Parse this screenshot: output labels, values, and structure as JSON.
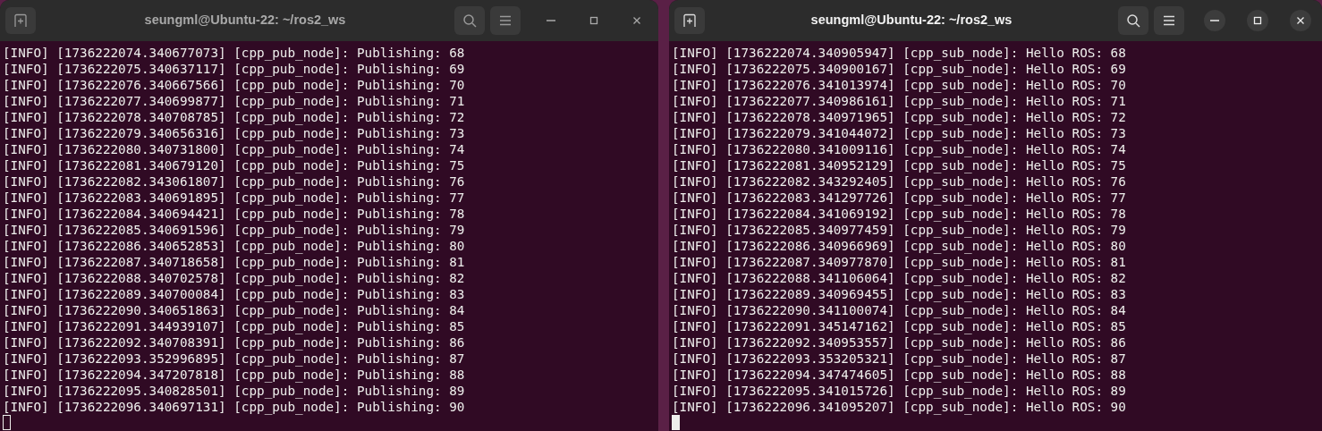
{
  "windows": [
    {
      "title": "seungml@Ubuntu-22: ~/ros2_ws",
      "active": false,
      "lines": [
        "[INFO] [1736222074.340677073] [cpp_pub_node]: Publishing: 68",
        "[INFO] [1736222075.340637117] [cpp_pub_node]: Publishing: 69",
        "[INFO] [1736222076.340667566] [cpp_pub_node]: Publishing: 70",
        "[INFO] [1736222077.340699877] [cpp_pub_node]: Publishing: 71",
        "[INFO] [1736222078.340708785] [cpp_pub_node]: Publishing: 72",
        "[INFO] [1736222079.340656316] [cpp_pub_node]: Publishing: 73",
        "[INFO] [1736222080.340731800] [cpp_pub_node]: Publishing: 74",
        "[INFO] [1736222081.340679120] [cpp_pub_node]: Publishing: 75",
        "[INFO] [1736222082.343061807] [cpp_pub_node]: Publishing: 76",
        "[INFO] [1736222083.340691895] [cpp_pub_node]: Publishing: 77",
        "[INFO] [1736222084.340694421] [cpp_pub_node]: Publishing: 78",
        "[INFO] [1736222085.340691596] [cpp_pub_node]: Publishing: 79",
        "[INFO] [1736222086.340652853] [cpp_pub_node]: Publishing: 80",
        "[INFO] [1736222087.340718658] [cpp_pub_node]: Publishing: 81",
        "[INFO] [1736222088.340702578] [cpp_pub_node]: Publishing: 82",
        "[INFO] [1736222089.340700084] [cpp_pub_node]: Publishing: 83",
        "[INFO] [1736222090.340651863] [cpp_pub_node]: Publishing: 84",
        "[INFO] [1736222091.344939107] [cpp_pub_node]: Publishing: 85",
        "[INFO] [1736222092.340708391] [cpp_pub_node]: Publishing: 86",
        "[INFO] [1736222093.352996895] [cpp_pub_node]: Publishing: 87",
        "[INFO] [1736222094.347207818] [cpp_pub_node]: Publishing: 88",
        "[INFO] [1736222095.340828501] [cpp_pub_node]: Publishing: 89",
        "[INFO] [1736222096.340697131] [cpp_pub_node]: Publishing: 90"
      ]
    },
    {
      "title": "seungml@Ubuntu-22: ~/ros2_ws",
      "active": true,
      "lines": [
        "[INFO] [1736222074.340905947] [cpp_sub_node]: Hello ROS: 68",
        "[INFO] [1736222075.340900167] [cpp_sub_node]: Hello ROS: 69",
        "[INFO] [1736222076.341013974] [cpp_sub_node]: Hello ROS: 70",
        "[INFO] [1736222077.340986161] [cpp_sub_node]: Hello ROS: 71",
        "[INFO] [1736222078.340971965] [cpp_sub_node]: Hello ROS: 72",
        "[INFO] [1736222079.341044072] [cpp_sub_node]: Hello ROS: 73",
        "[INFO] [1736222080.341009116] [cpp_sub_node]: Hello ROS: 74",
        "[INFO] [1736222081.340952129] [cpp_sub_node]: Hello ROS: 75",
        "[INFO] [1736222082.343292405] [cpp_sub_node]: Hello ROS: 76",
        "[INFO] [1736222083.341297726] [cpp_sub_node]: Hello ROS: 77",
        "[INFO] [1736222084.341069192] [cpp_sub_node]: Hello ROS: 78",
        "[INFO] [1736222085.340977459] [cpp_sub_node]: Hello ROS: 79",
        "[INFO] [1736222086.340966969] [cpp_sub_node]: Hello ROS: 80",
        "[INFO] [1736222087.340977870] [cpp_sub_node]: Hello ROS: 81",
        "[INFO] [1736222088.341106064] [cpp_sub_node]: Hello ROS: 82",
        "[INFO] [1736222089.340969455] [cpp_sub_node]: Hello ROS: 83",
        "[INFO] [1736222090.341100074] [cpp_sub_node]: Hello ROS: 84",
        "[INFO] [1736222091.345147162] [cpp_sub_node]: Hello ROS: 85",
        "[INFO] [1736222092.340953557] [cpp_sub_node]: Hello ROS: 86",
        "[INFO] [1736222093.353205321] [cpp_sub_node]: Hello ROS: 87",
        "[INFO] [1736222094.347474605] [cpp_sub_node]: Hello ROS: 88",
        "[INFO] [1736222095.341015726] [cpp_sub_node]: Hello ROS: 89",
        "[INFO] [1736222096.341095207] [cpp_sub_node]: Hello ROS: 90"
      ]
    }
  ]
}
